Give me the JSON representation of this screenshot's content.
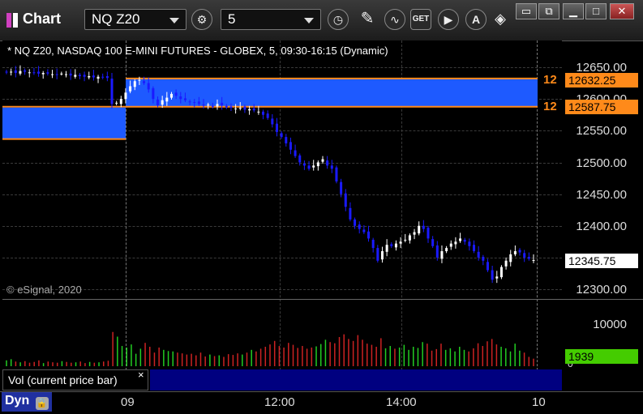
{
  "toolbar": {
    "app_title": "Chart",
    "symbol": "NQ Z20",
    "interval": "5"
  },
  "chart_header": {
    "description": "* NQ Z20, NASDAQ 100 E-MINI FUTURES - GLOBEX, 5, 09:30-16:15 (Dynamic)",
    "copyright": "© eSignal, 2020"
  },
  "price_axis": {
    "ticks": [
      "12650.00",
      "12600.00",
      "12550.00",
      "12500.00",
      "12450.00",
      "12400.00",
      "12300.00"
    ],
    "high_tag": "12632.25",
    "low_tag": "12587.75",
    "high_badge": "12",
    "low_badge": "12",
    "last_price": "12345.75"
  },
  "volume_axis": {
    "tick": "10000",
    "zero": "0",
    "last_volume": "1939"
  },
  "volume_panel": {
    "label": "Vol (current price bar)",
    "close": "×"
  },
  "time_axis": {
    "ticks": [
      "09",
      "12:00",
      "14:00",
      "10"
    ]
  },
  "footer": {
    "mode": "Dyn"
  },
  "colors": {
    "up": "#ffffff",
    "down": "#1a1aff",
    "zone": "#1e5aff",
    "zone_border": "#ff8a1a",
    "vol_up": "#22cc22",
    "vol_down": "#cc2222",
    "last_vol": "#44cc00"
  },
  "chart_data": {
    "type": "candlestick",
    "title": "NQ Z20, NASDAQ 100 E-MINI FUTURES - GLOBEX, 5, 09:30-16:15 (Dynamic)",
    "ylim": [
      12290,
      12665
    ],
    "zones": [
      {
        "high": 12632.25,
        "low": 12587.75
      },
      {
        "high": 12588,
        "low": 12538
      }
    ],
    "closes": [
      12642,
      12643,
      12641,
      12644,
      12643,
      12642,
      12641,
      12640,
      12641,
      12640,
      12639,
      12638,
      12640,
      12639,
      12637,
      12638,
      12636,
      12635,
      12636,
      12634,
      12635,
      12634,
      12633,
      12592,
      12594,
      12600,
      12610,
      12620,
      12628,
      12630,
      12625,
      12615,
      12600,
      12590,
      12598,
      12602,
      12608,
      12605,
      12600,
      12598,
      12595,
      12594,
      12592,
      12590,
      12591,
      12588,
      12592,
      12590,
      12587,
      12586,
      12585,
      12586,
      12583,
      12584,
      12582,
      12580,
      12575,
      12570,
      12560,
      12548,
      12540,
      12530,
      12520,
      12510,
      12500,
      12495,
      12490,
      12495,
      12500,
      12505,
      12495,
      12490,
      12470,
      12450,
      12430,
      12410,
      12400,
      12395,
      12390,
      12380,
      12365,
      12345,
      12360,
      12370,
      12368,
      12372,
      12375,
      12378,
      12385,
      12390,
      12400,
      12395,
      12380,
      12368,
      12350,
      12360,
      12365,
      12372,
      12375,
      12380,
      12375,
      12368,
      12360,
      12350,
      12345,
      12330,
      12315,
      12320,
      12335,
      12345,
      12355,
      12360,
      12358,
      12350,
      12348,
      12346
    ],
    "volume": [
      1500,
      1800,
      1200,
      1000,
      1300,
      900,
      1100,
      1500,
      800,
      1200,
      1000,
      900,
      1300,
      1100,
      900,
      1000,
      1200,
      800,
      1100,
      900,
      1000,
      1200,
      1400,
      8800,
      7600,
      5200,
      4800,
      5600,
      3200,
      4500,
      6000,
      5000,
      3500,
      4800,
      4200,
      3900,
      3800,
      3500,
      3300,
      3000,
      3200,
      2800,
      3500,
      2500,
      3000,
      2600,
      2800,
      2400,
      3100,
      2900,
      3300,
      3000,
      3500,
      4200,
      3800,
      4500,
      5000,
      5600,
      6500,
      5200,
      4800,
      6000,
      5500,
      4700,
      5200,
      4500,
      4800,
      5100,
      5700,
      6800,
      6200,
      5900,
      7500,
      8200,
      7000,
      6500,
      8000,
      6800,
      5800,
      5500,
      5000,
      7200,
      4600,
      5200,
      4500,
      4800,
      5500,
      4200,
      5000,
      4700,
      6200,
      5800,
      4000,
      4400,
      5800,
      4200,
      4600,
      3800,
      5000,
      4200,
      3800,
      4600,
      5900,
      5200,
      6400,
      7000,
      5600,
      5000,
      4600,
      3800,
      5800,
      4000,
      3500,
      2400,
      1939
    ],
    "xlabels": [
      "09",
      "12:00",
      "14:00",
      "10"
    ]
  }
}
